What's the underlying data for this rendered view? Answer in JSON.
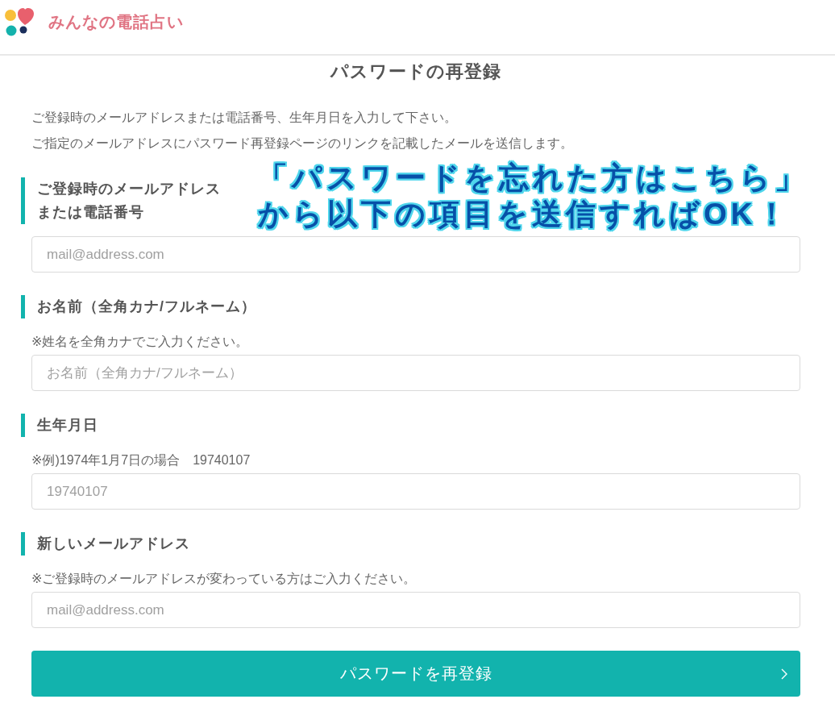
{
  "header": {
    "logo_text": "みんなの電話占い"
  },
  "title": "パスワードの再登録",
  "intro": [
    "ご登録時のメールアドレスまたは電話番号、生年月日を入力して下さい。",
    "ご指定のメールアドレスにパスワード再登録ページのリンクを記載したメールを送信します。"
  ],
  "annotation": {
    "lines": [
      "「パスワードを忘れた方はこちら」",
      "から以下の項目を送信すればOK！"
    ]
  },
  "fields": [
    {
      "label": [
        "ご登録時のメールアドレス",
        "または電話番号"
      ],
      "placeholder": "mail@address.com"
    },
    {
      "label": [
        "お名前（全角カナ/フルネーム）"
      ],
      "note": "※姓名を全角カナでご入力ください。",
      "placeholder": "お名前（全角カナ/フルネーム）"
    },
    {
      "label": [
        "生年月日"
      ],
      "note": "※例)1974年1月7日の場合　19740107",
      "placeholder": "19740107"
    },
    {
      "label": [
        "新しいメールアドレス"
      ],
      "note": "※ご登録時のメールアドレスが変わっている方はご入力ください。",
      "placeholder": "mail@address.com"
    }
  ],
  "submit_button": {
    "label": "パスワードを再登録"
  }
}
